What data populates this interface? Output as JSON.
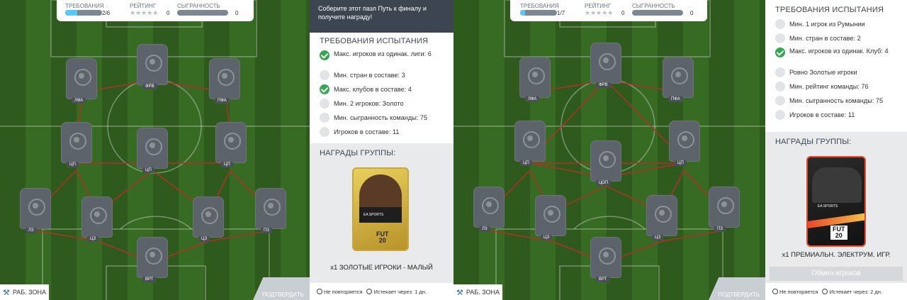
{
  "left_panel": {
    "top": {
      "req_label": "ТРЕБОВАНИЯ",
      "req_count": "2/6",
      "req_progress": 0.33,
      "rating_label": "РЕЙТИНГ",
      "rating_stars": "★★★★★",
      "rating_value": "0",
      "chem_label": "СЫГРАННОСТЬ",
      "chem_value": "0"
    },
    "positions": [
      "ЛФА",
      "ФРВ",
      "ПФА",
      "ЦП",
      "ЦП",
      "ЦП",
      "ЛЗ",
      "ЦЗ",
      "ЦЗ",
      "ПЗ",
      "ВРТ"
    ],
    "workspace": "РАБ. ЗОНА",
    "submit": "ПОДТВЕРДИТЬ"
  },
  "left_side": {
    "banner": "Соберите этот пазл Путь к финалу и получите награду!",
    "req_title": "ТРЕБОВАНИЯ ИСПЫТАНИЯ",
    "reqs": [
      {
        "text": "Макс. игроков из одинак. лиги: 6",
        "done": true
      },
      {
        "text": "Мин. стран в составе: 3",
        "done": false
      },
      {
        "text": "Макс. клубов в составе: 4",
        "done": true
      },
      {
        "text": "Мин. 2 игроков: Золото",
        "done": false
      },
      {
        "text": "Мин. сыгранность команды: 75",
        "done": false
      },
      {
        "text": "Игроков в составе: 11",
        "done": false
      }
    ],
    "rew_title": "НАГРАДЫ ГРУППЫ:",
    "card_brand": "FUT",
    "card_year": "20",
    "card_sponsor": "EA SPORTS",
    "reward": "x1 ЗОЛОТЫЕ ИГРОКИ - МАЛЫЙ",
    "foot_repeat": "Не повторяется",
    "foot_expire": "Истекает через: 1 дн."
  },
  "right_panel": {
    "top": {
      "req_label": "ТРЕБОВАНИЯ",
      "req_count": "1/7",
      "req_progress": 0.14,
      "rating_label": "РЕЙТИНГ",
      "rating_stars": "★★★★★",
      "rating_value": "0",
      "chem_label": "СЫГРАННОСТЬ",
      "chem_value": "0"
    },
    "positions": [
      "ЛФА",
      "ФРВ",
      "ПФА",
      "ЦП",
      "ЦП",
      "ЦОП",
      "ЛЗ",
      "ЦЗ",
      "ЦЗ",
      "ПЗ",
      "ВРТ"
    ],
    "workspace": "РАБ. ЗОНА",
    "submit": "ПОДТВЕРДИТЬ"
  },
  "right_side": {
    "req_title": "ТРЕБОВАНИЯ ИСПЫТАНИЯ",
    "reqs": [
      {
        "text": "Мин. 1 игрок из Румынии",
        "done": false
      },
      {
        "text": "Мин. стран в составе: 2",
        "done": false
      },
      {
        "text": "Макс. игроков из одинак. Клуб: 4",
        "done": true
      },
      {
        "text": "Ровно Золотые игроки",
        "done": false
      },
      {
        "text": "Мин. рейтинг команды: 76",
        "done": false
      },
      {
        "text": "Мин. сыгранность команды: 75",
        "done": false
      },
      {
        "text": "Игроков в составе: 11",
        "done": false
      }
    ],
    "rew_title": "НАГРАДЫ ГРУППЫ:",
    "card_brand": "FUT",
    "card_year": "20",
    "card_sponsor": "EA SPORTS",
    "reward": "x1 ПРЕМИАЛЬН. ЭЛЕКТРУМ. ИГР.",
    "exchange": "Обмен игроков",
    "foot_repeat": "Не повторяется",
    "foot_expire": "Истекает через: 2 дн."
  },
  "colors": {
    "progress": "#5cc7f0",
    "check": "#34a853",
    "link": "#c62828",
    "gold": "#d7b845",
    "premium": "#e84a2a"
  }
}
